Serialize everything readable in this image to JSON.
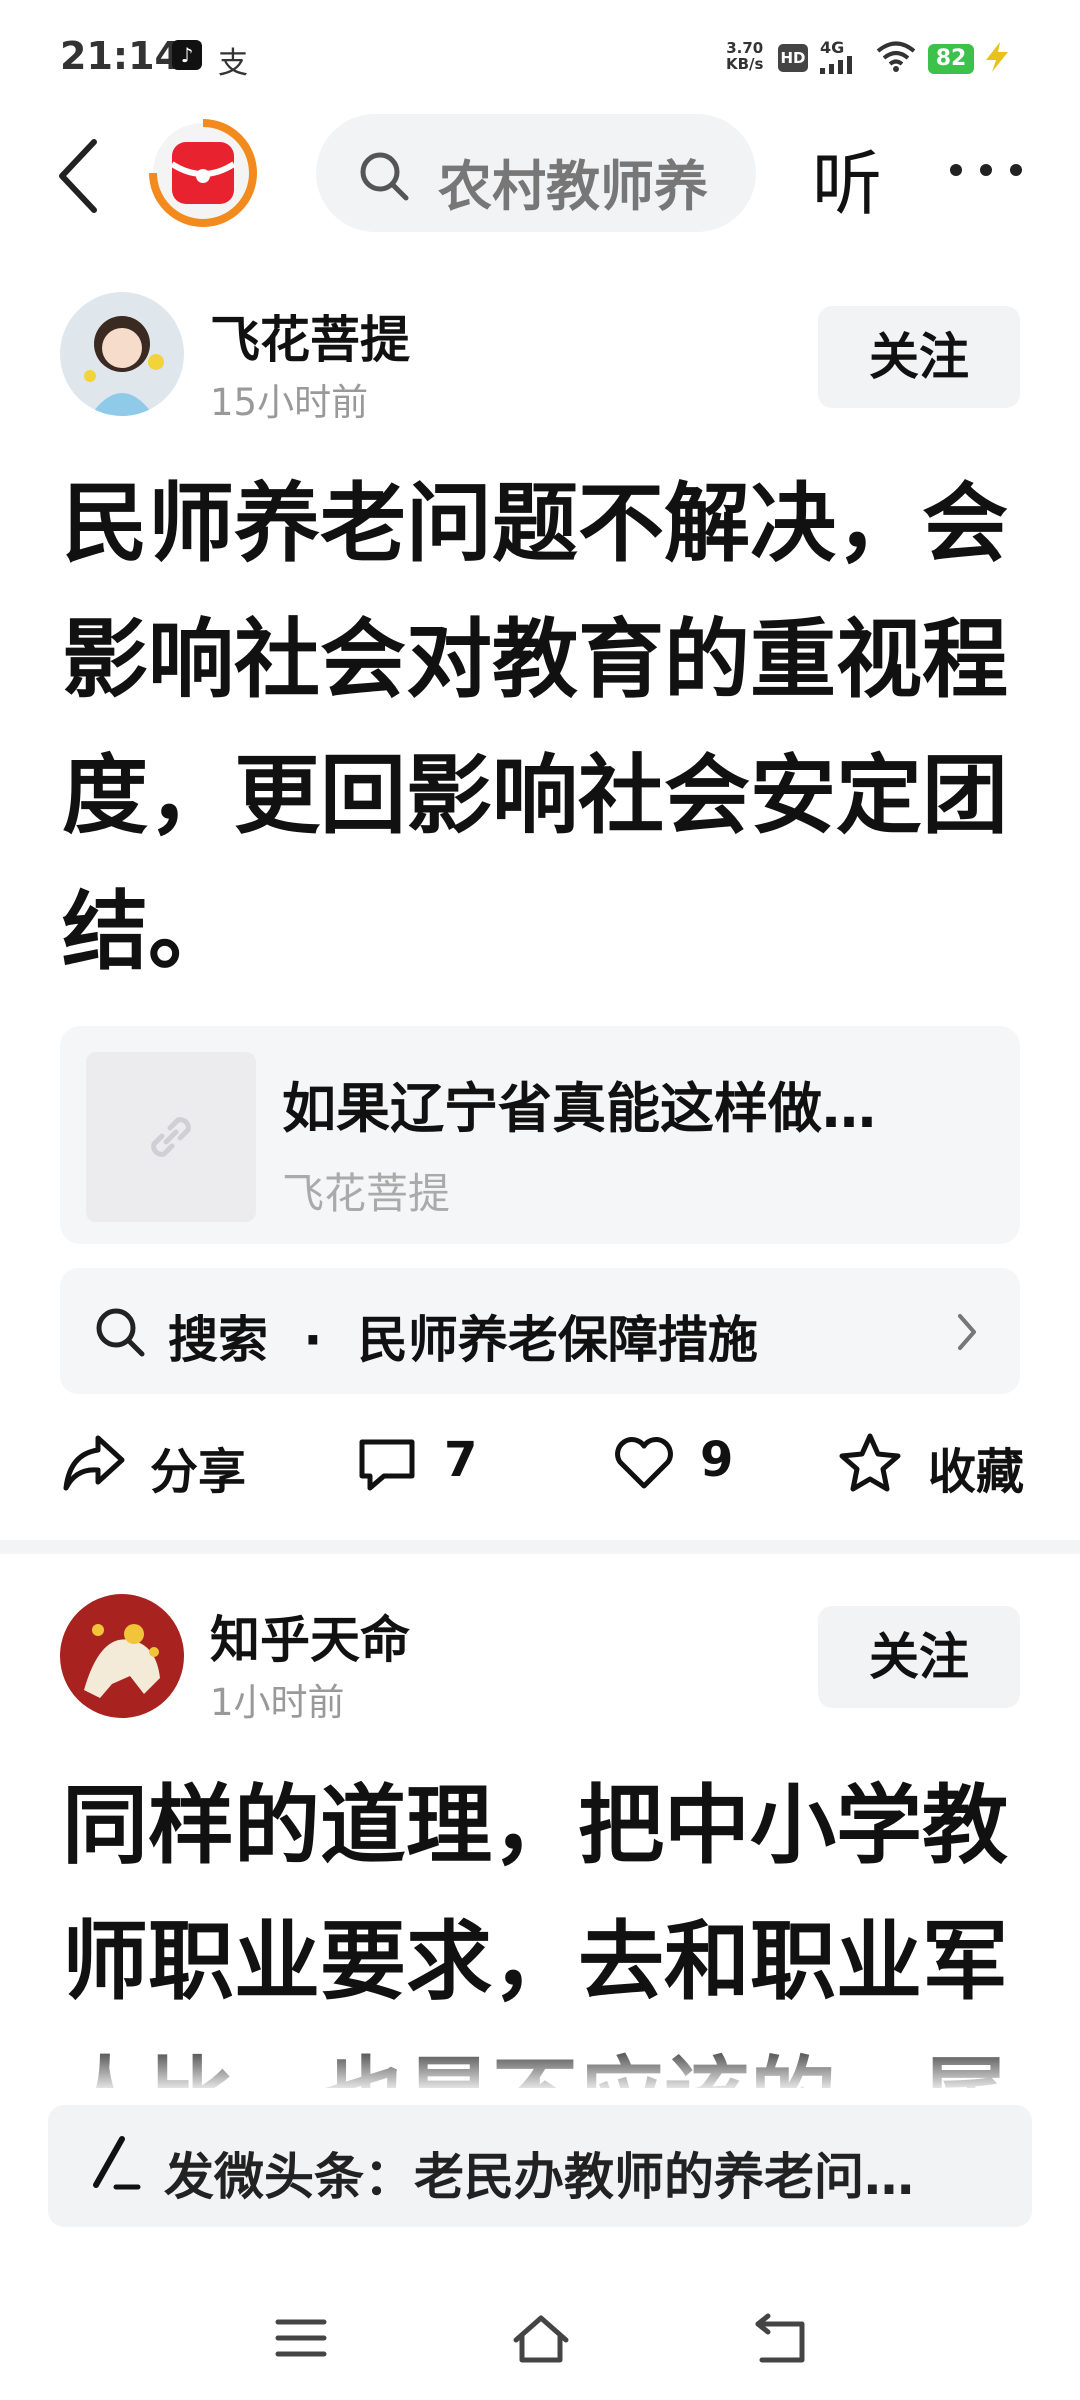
{
  "status_bar": {
    "time": "21:14",
    "app_icon_2": "支",
    "net_speed_value": "3.70",
    "net_speed_unit": "KB/s",
    "hd": "HD",
    "network": "4G",
    "battery": "82"
  },
  "nav": {
    "search_text": "农村教师养",
    "listen_label": "听"
  },
  "posts": [
    {
      "author": "飞花菩提",
      "time": "15小时前",
      "follow_label": "关注",
      "text": "民师养老问题不解决，会影响社会对教育的重视程度，更回影响社会安定团结。",
      "link_card": {
        "title": "如果辽宁省真能这样做…",
        "author": "飞花菩提"
      },
      "search_suggestion": {
        "prefix": "搜索",
        "separator": "·",
        "query": "民师养老保障措施"
      },
      "actions": {
        "share": "分享",
        "comments": "7",
        "likes": "9",
        "collect": "收藏"
      }
    },
    {
      "author": "知乎天命",
      "time": "1小时前",
      "follow_label": "关注",
      "text": "同样的道理，把中小学教师职业要求，去和职业军人比，也是不应该的，属"
    }
  ],
  "compose_bar": {
    "text": "发微头条：老民办教师的养老问…"
  },
  "colors": {
    "accent_orange": "#f28a1e",
    "brand_red": "#e8232f",
    "battery_green": "#3cc14a"
  }
}
